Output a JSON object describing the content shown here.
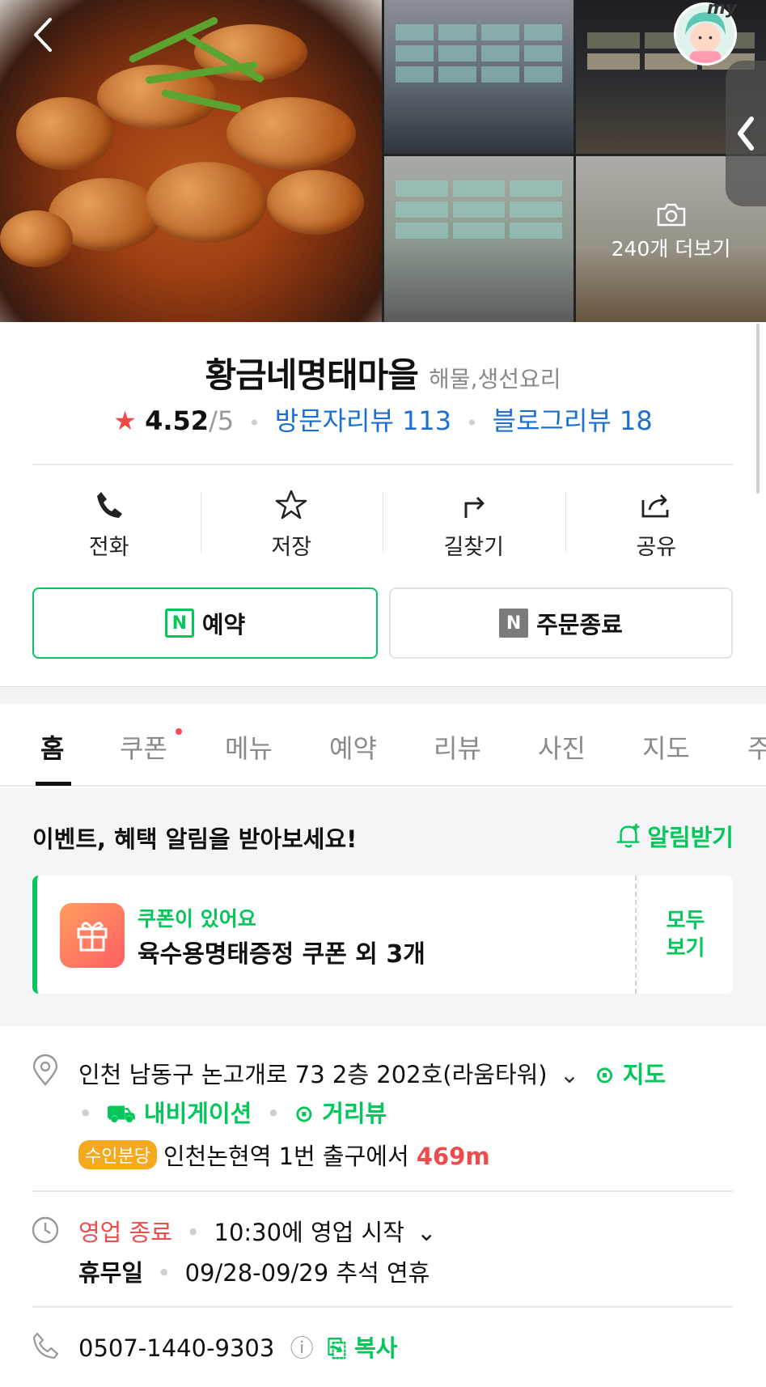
{
  "header": {
    "more_photos_label": "240개 더보기",
    "my_label": "my"
  },
  "place": {
    "name": "황금네명태마을",
    "category": "해물,생선요리",
    "rating": "4.52",
    "rating_max": "/5",
    "visitor_reviews": "방문자리뷰 113",
    "blog_reviews": "블로그리뷰 18"
  },
  "actions": [
    {
      "label": "전화",
      "icon": "phone-icon"
    },
    {
      "label": "저장",
      "icon": "star-outline-icon"
    },
    {
      "label": "길찾기",
      "icon": "directions-icon"
    },
    {
      "label": "공유",
      "icon": "share-icon"
    }
  ],
  "buttons": {
    "reserve": "예약",
    "order": "주문종료",
    "n_letter": "N"
  },
  "tabs": [
    "홈",
    "쿠폰",
    "메뉴",
    "예약",
    "리뷰",
    "사진",
    "지도",
    "주"
  ],
  "event": {
    "title": "이벤트, 혜택 알림을 받아보세요!",
    "alarm_label": "알림받기",
    "coupon_label": "쿠폰이 있어요",
    "coupon_desc_main": "육수용명태증정 쿠폰 외 ",
    "coupon_desc_count": "3개",
    "view_all_1": "모두",
    "view_all_2": "보기"
  },
  "address": {
    "text": "인천 남동구 논고개로 73 2층 202호(라움타워)",
    "map_label": "지도",
    "navigation_label": "내비게이션",
    "streetview_label": "거리뷰",
    "subway_line": "수인분당",
    "station_text": "인천논현역 1번 출구에서 ",
    "distance": "469m"
  },
  "hours": {
    "status": "영업 종료",
    "open_text": "10:30에 영업 시작",
    "holiday_label": "휴무일",
    "holiday_text": "09/28-09/29 추석 연휴"
  },
  "phone": {
    "number": "0507-1440-9303",
    "copy_label": "복사"
  },
  "colors": {
    "accent_green": "#03c75a",
    "link_blue": "#1b6fd0",
    "alert_red": "#f04b4b"
  }
}
